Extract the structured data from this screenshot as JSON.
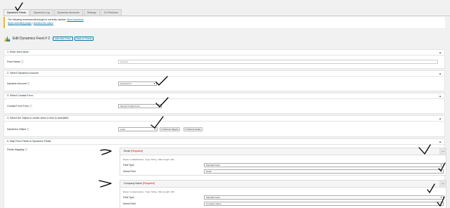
{
  "tabs": [
    {
      "label": "Dynamics Feeds",
      "active": true
    },
    {
      "label": "Dynamics Log",
      "active": false
    },
    {
      "label": "Dynamics Accounts",
      "active": false
    },
    {
      "label": "Settings",
      "active": false
    },
    {
      "label": "Go Premium",
      "active": false
    }
  ],
  "notice": {
    "text": "The following recommended plugin is currently inactive:",
    "plugin_link": "WooCommerce",
    "begin_link": "Begin activating plugin",
    "dismiss_link": "Dismiss this notice"
  },
  "header": {
    "title": "Edit Dynamics Feed # 2",
    "add_new_label": "Add New Feed",
    "back_label": "Back to Feeds"
  },
  "sections": {
    "s1": {
      "title": "1. Enter feed name.",
      "label": "Feed Name ⓘ",
      "value": "Feed #2"
    },
    "s2": {
      "title": "2. Select Dynamics Account.",
      "label": "Dynamic Account ⓘ",
      "value": "Account # 1"
    },
    "s3": {
      "title": "3. Select Contact Form.",
      "label": "Contact Form Form ⓘ",
      "value": "Simple Contact Form"
    },
    "s4": {
      "title": "4. Select the Object to create when a form is submitted.",
      "label": "Dynamics Object ⓘ",
      "value": "Lead",
      "refresh_objects": "Refresh Objects",
      "refresh_fields": "Refresh Fields"
    },
    "s5": {
      "title": "5. Map Form Fields to Dynamics Fields.",
      "label": "Fields Mapping ⓘ"
    }
  },
  "mappings": [
    {
      "name": "Email",
      "required": "(Required)",
      "meta": "Name: emailaddress1 , Type: String , Max Length: 100",
      "field_type_label": "Field Type",
      "field_type_value": "Standard Field",
      "select_field_label": "Select Field",
      "select_field_value": "Email"
    },
    {
      "name": "Company Name",
      "required": "(Required)",
      "meta": "Name: companyname , Type: String , Max Length: 100",
      "field_type_label": "Field Type",
      "field_type_value": "Standard Field",
      "select_field_label": "Select Field",
      "select_field_value": "Company Name"
    }
  ],
  "icons": {
    "collapse": "▲",
    "dropdown": "▼",
    "toggle": "—",
    "refresh": "↻"
  },
  "colors": {
    "accent": "#0073aa",
    "notice_border": "#ffb900",
    "required": "#dd0000"
  }
}
